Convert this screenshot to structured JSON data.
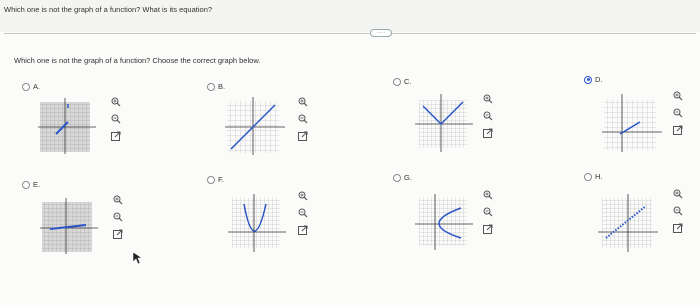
{
  "question": {
    "main": "Which one is not the graph of a function? What is its equation?",
    "sub": "Which one is not the graph of a function? Choose the correct graph below."
  },
  "divider_button": "·····",
  "options": [
    {
      "id": "A",
      "label": "A.",
      "selected": false
    },
    {
      "id": "B",
      "label": "B.",
      "selected": false
    },
    {
      "id": "C",
      "label": "C.",
      "selected": false
    },
    {
      "id": "D",
      "label": "D.",
      "selected": true
    },
    {
      "id": "E",
      "label": "E.",
      "selected": false
    },
    {
      "id": "F",
      "label": "F.",
      "selected": false
    },
    {
      "id": "G",
      "label": "G.",
      "selected": false
    },
    {
      "id": "H",
      "label": "H.",
      "selected": false
    }
  ],
  "tools": [
    "zoom-in-icon",
    "zoom-out-icon",
    "open-new-window-icon"
  ],
  "colors": {
    "accent": "#2a55c8",
    "grid": "#9a9a9a",
    "curve": "#2a55c8"
  }
}
